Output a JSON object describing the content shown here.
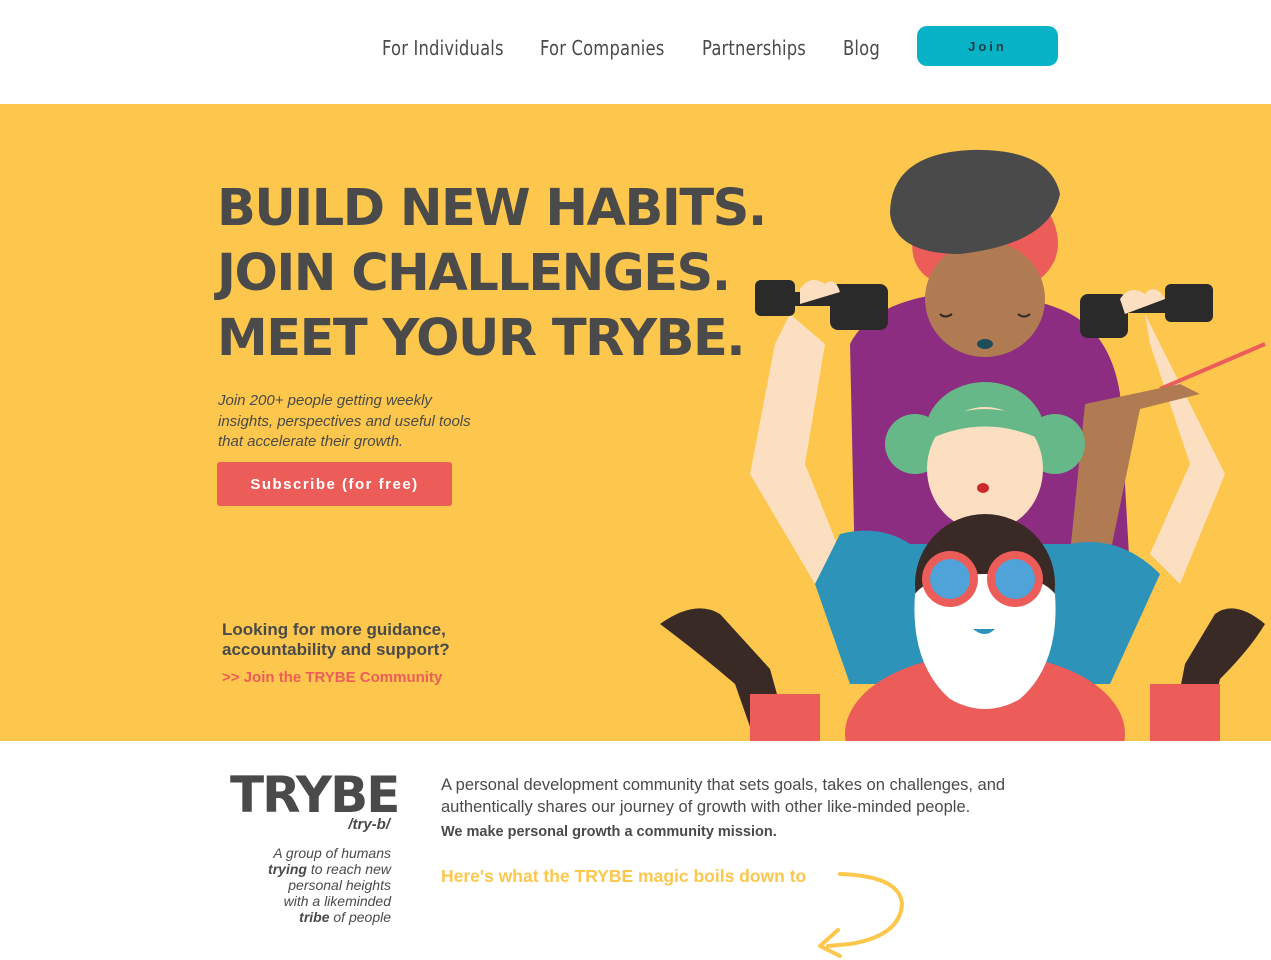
{
  "nav": {
    "items": [
      {
        "label": "For Individuals"
      },
      {
        "label": "For Companies"
      },
      {
        "label": "Partnerships"
      },
      {
        "label": "Blog"
      }
    ],
    "join_label": "Join"
  },
  "hero": {
    "headline": [
      "BUILD NEW HABITS.",
      "JOIN CHALLENGES.",
      "MEET YOUR TRYBE."
    ],
    "subtext": "Join 200+ people getting weekly insights, perspectives and useful tools that accelerate their growth.",
    "subscribe_label": "Subscribe (for free)",
    "guidance": [
      "Looking for more guidance,",
      "accountability and support?"
    ],
    "community_link": ">> Join the TRYBE Community"
  },
  "definition": {
    "word": "TRYBE",
    "phonetic": "/try-b/",
    "parts": [
      "A group of humans",
      "trying",
      "to reach new",
      "personal heights",
      "with a likeminded",
      "tribe",
      "of people"
    ]
  },
  "about": {
    "description": "A personal development community that sets goals, takes on challenges, and authentically shares our journey of growth with other like-minded people.",
    "mission": "We make personal growth a community mission.",
    "magic": "Here's what the TRYBE magic boils down to"
  },
  "colors": {
    "hero_bg": "#fcc74c",
    "accent_red": "#ec5d5a",
    "join_teal": "#08b3c7",
    "text": "#4a4a4a"
  }
}
